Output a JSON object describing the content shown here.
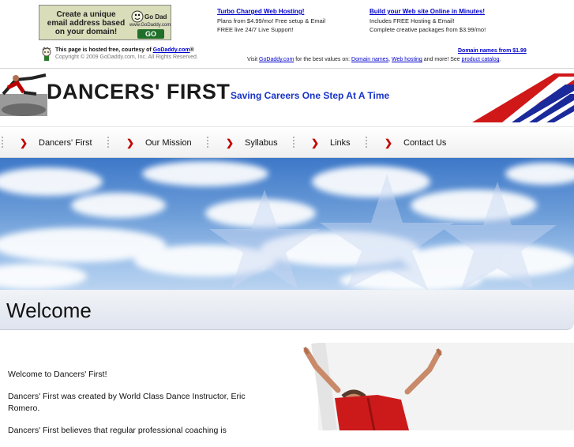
{
  "ad": {
    "banner_lines": [
      "Create a unique",
      "email address based",
      "on your domain!"
    ],
    "banner_logo": "Go Daddy",
    "banner_url": "www.GoDaddy.com",
    "banner_go": "GO",
    "col1": {
      "title": "Turbo Charged Web Hosting!",
      "line1": "Plans from $4.99/mo! Free setup & Email",
      "line2": "FREE live 24/7 Live Support!"
    },
    "col2": {
      "title": "Build your Web site Online in Minutes!",
      "line1": "Includes FREE Hosting & Email!",
      "line2": "Complete creative packages from $3.99/mo!"
    },
    "hosted_prefix": "This page is hosted free, courtesy of ",
    "hosted_link": "GoDaddy.com",
    "hosted_suffix": "®",
    "copyright": "Copyright © 2009 GoDaddy.com, Inc. All Rights Reserved.",
    "domain_promo": "Domain names from $1.99",
    "visit": {
      "prefix": "Visit ",
      "link1": "GoDaddy.com",
      "mid1": " for the best values on: ",
      "link2": "Domain names",
      "comma": ", ",
      "link3": "Web hosting",
      "mid2": " and more! See ",
      "link4": "product catalog",
      "end": "."
    }
  },
  "site": {
    "title": "DANCERS' FIRST",
    "tagline": "Saving Careers One Step At A Time"
  },
  "nav": [
    "Dancers' First",
    "Our Mission",
    "Syllabus",
    "Links",
    "Contact Us"
  ],
  "welcome": {
    "title": "Welcome"
  },
  "content": {
    "p1": "Welcome to Dancers' First!",
    "p2": "Dancers' First was created by World Class Dance Instructor, Eric Romero.",
    "p3": "Dancers' First believes that regular professional coaching is"
  },
  "colors": {
    "link": "#0000cc",
    "tagline": "#1733c7",
    "nav_chevron": "#c40000",
    "sky": "#3d78c8",
    "stripe_red": "#d01818",
    "stripe_blue": "#1a2a9a"
  }
}
